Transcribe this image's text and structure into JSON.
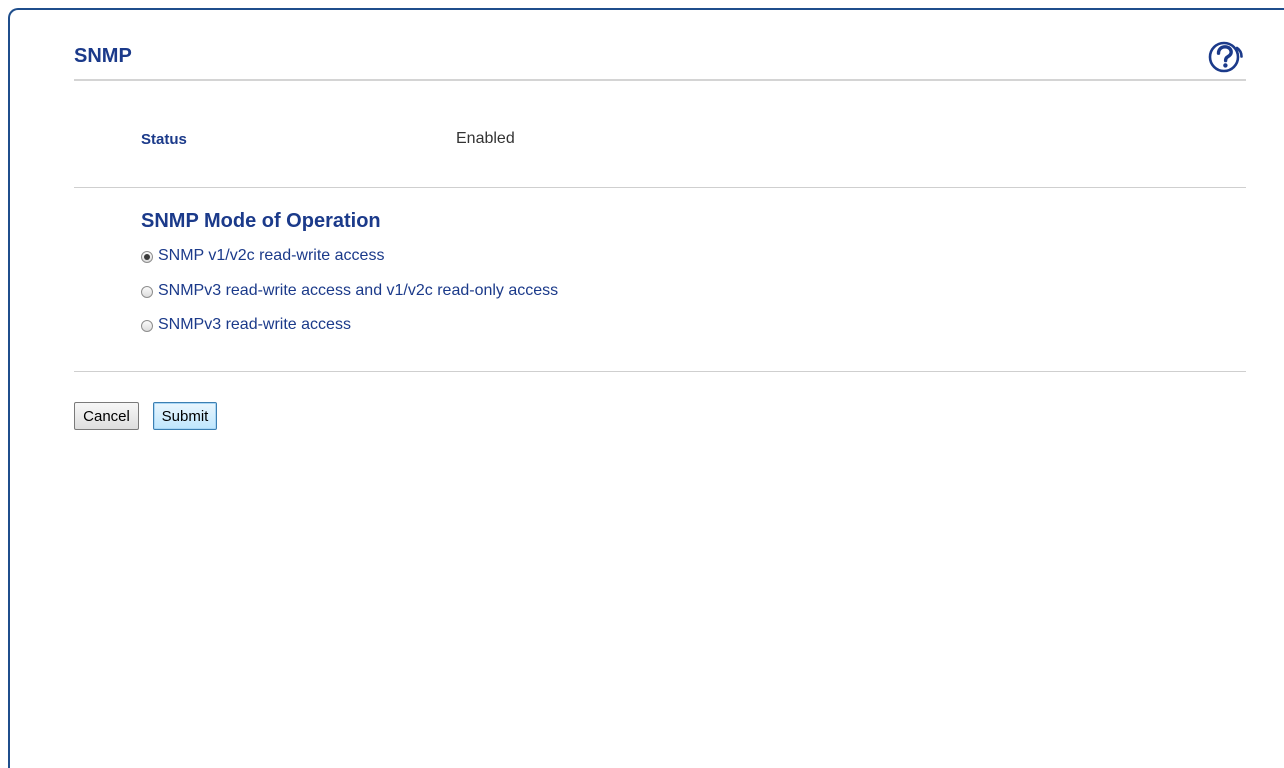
{
  "page": {
    "title": "SNMP",
    "help_icon": "help-question-icon"
  },
  "status": {
    "label": "Status",
    "value": "Enabled"
  },
  "mode": {
    "heading": "SNMP Mode of Operation",
    "options": [
      {
        "label": "SNMP v1/v2c read-write access",
        "selected": true
      },
      {
        "label": "SNMPv3 read-write access and v1/v2c read-only access",
        "selected": false
      },
      {
        "label": "SNMPv3 read-write access",
        "selected": false
      }
    ]
  },
  "buttons": {
    "cancel": "Cancel",
    "submit": "Submit"
  },
  "colors": {
    "heading": "#1b3a8a",
    "frame": "#1f4e8c"
  }
}
